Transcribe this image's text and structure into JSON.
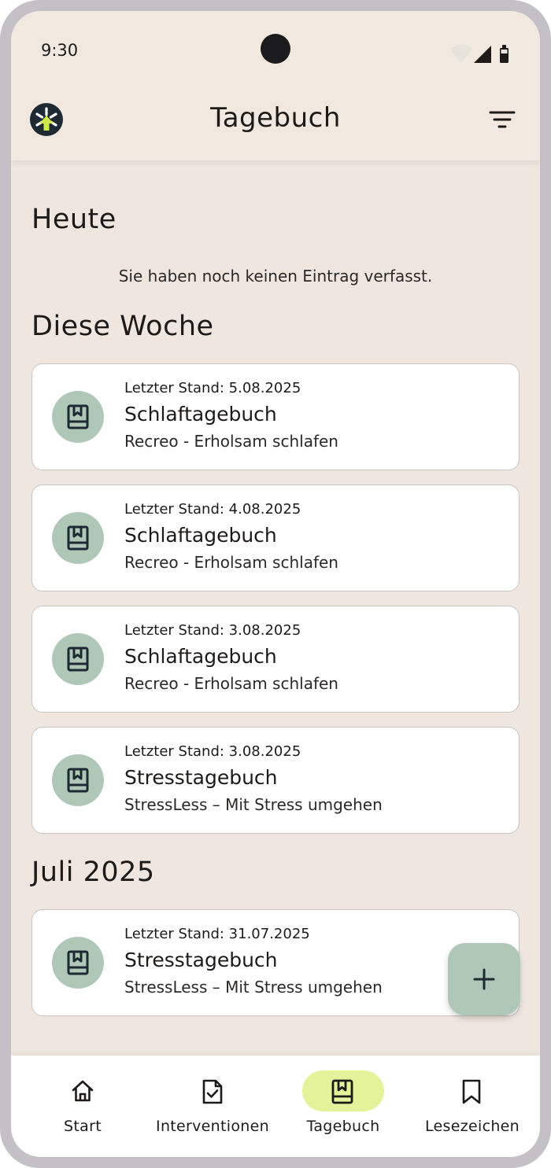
{
  "status_bar": {
    "time": "9:30"
  },
  "app_bar": {
    "title": "Tagebuch"
  },
  "sections": {
    "today": {
      "title": "Heute",
      "empty_message": "Sie haben noch keinen Eintrag verfasst."
    },
    "this_week": {
      "title": "Diese Woche"
    },
    "july": {
      "title": "Juli 2025"
    }
  },
  "entries": [
    {
      "date": "Letzter Stand: 5.08.2025",
      "title": "Schlaftagebuch",
      "subtitle": "Recreo - Erholsam schlafen"
    },
    {
      "date": "Letzter Stand: 4.08.2025",
      "title": "Schlaftagebuch",
      "subtitle": "Recreo - Erholsam schlafen"
    },
    {
      "date": "Letzter Stand: 3.08.2025",
      "title": "Schlaftagebuch",
      "subtitle": "Recreo - Erholsam schlafen"
    },
    {
      "date": "Letzter Stand: 3.08.2025",
      "title": "Stresstagebuch",
      "subtitle": "StressLess – Mit Stress umgehen"
    },
    {
      "date": "Letzter Stand: 31.07.2025",
      "title": "Stresstagebuch",
      "subtitle": "StressLess – Mit Stress umgehen"
    }
  ],
  "bottom_nav": {
    "items": [
      {
        "label": "Start",
        "icon": "home-icon",
        "active": false
      },
      {
        "label": "Interventionen",
        "icon": "document-check-icon",
        "active": false
      },
      {
        "label": "Tagebuch",
        "icon": "journal-icon",
        "active": true
      },
      {
        "label": "Lesezeichen",
        "icon": "bookmark-icon",
        "active": false
      }
    ]
  },
  "colors": {
    "background": "#efe7df",
    "card_icon_bg": "#afc7b7",
    "fab_bg": "#afc7b7",
    "nav_active": "#e4f29a",
    "logo_dark": "#1d2a33",
    "logo_accent": "#cfe84a"
  }
}
